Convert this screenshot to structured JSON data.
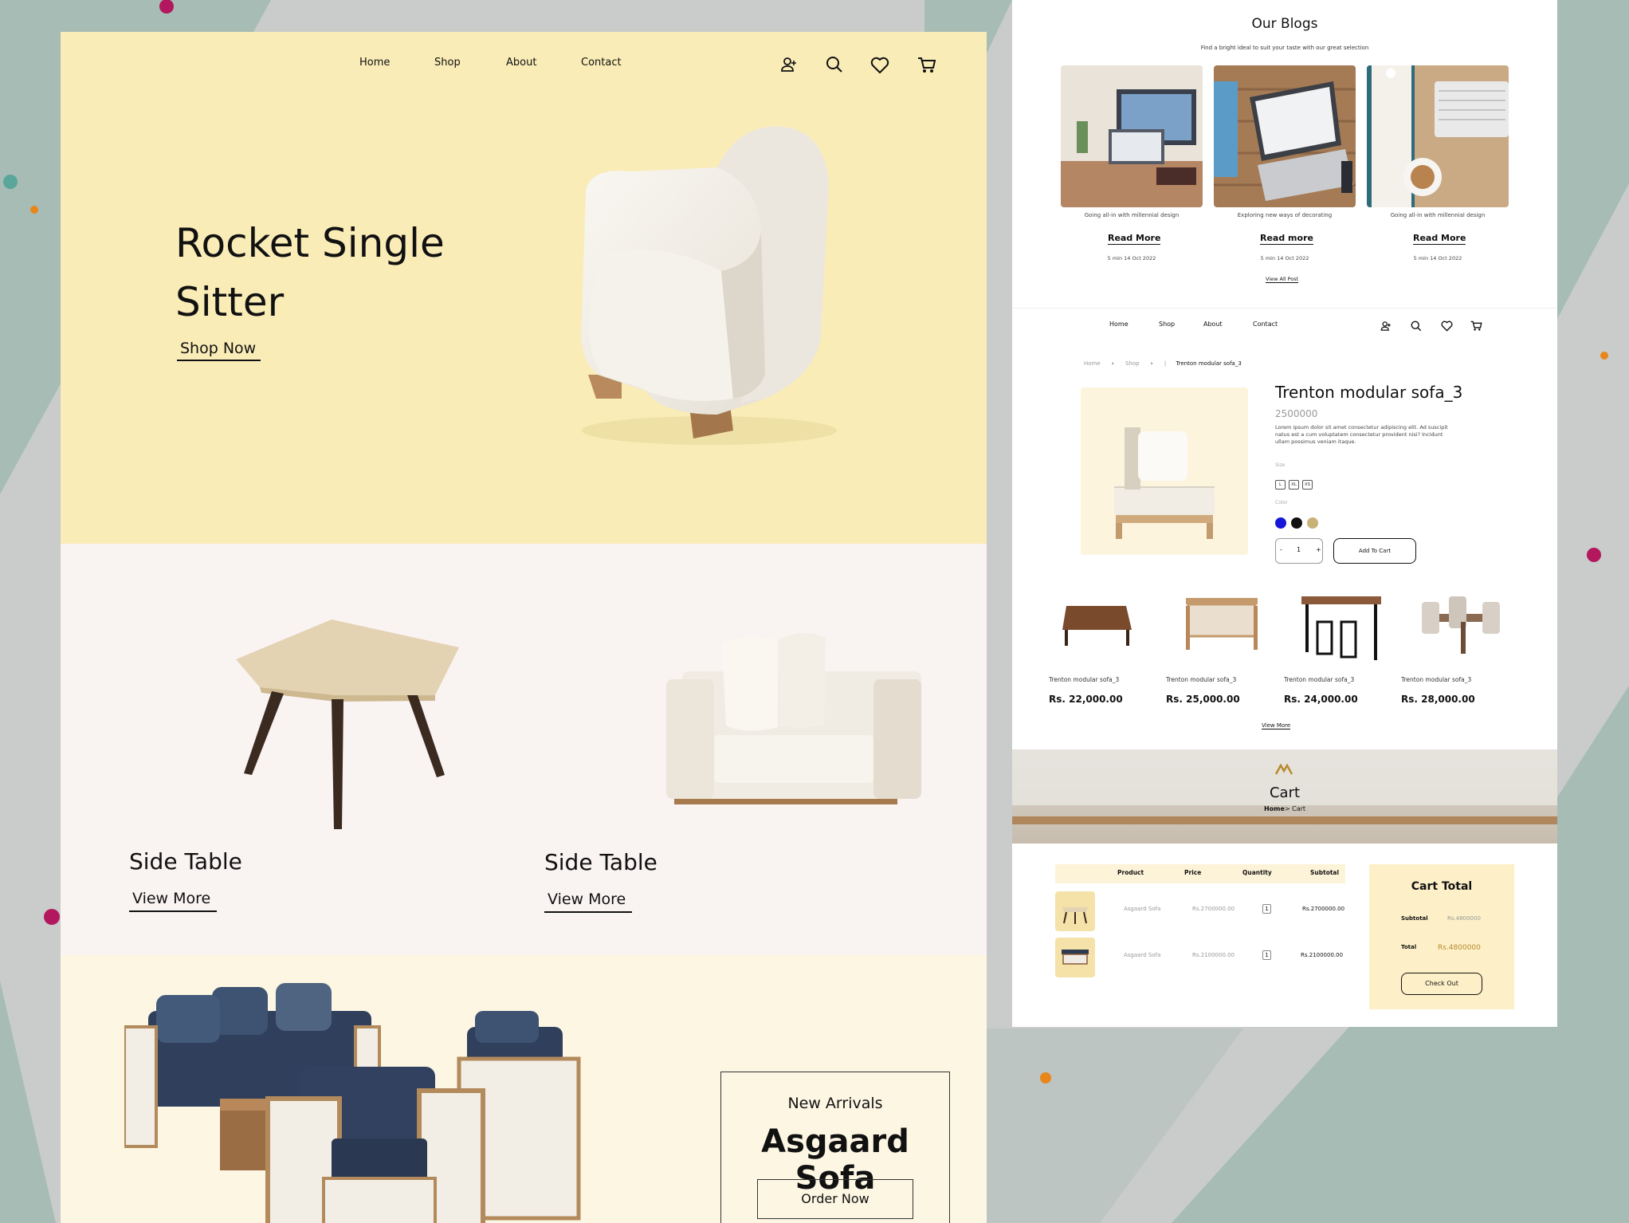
{
  "colors": {
    "background": "#c9cccb",
    "teal_band": "#a6bcb5",
    "hero_bg": "#f9ecb7",
    "section2_bg": "#f9f3f2",
    "section3_bg": "#fdf6e3",
    "accent_gold": "#b88a2e",
    "dot_magenta": "#b3185f",
    "dot_orange": "#e8861c",
    "dot_teal": "#5aa69a"
  },
  "left_page": {
    "nav": {
      "links": [
        "Home",
        "Shop",
        "About",
        "Contact"
      ],
      "icons": [
        "account-icon",
        "search-icon",
        "heart-icon",
        "cart-icon"
      ]
    },
    "hero": {
      "title": "Rocket Single Sitter",
      "cta": "Shop Now"
    },
    "products": [
      {
        "title": "Side Table",
        "link": "View More"
      },
      {
        "title": "Side Table",
        "link": "View More"
      }
    ],
    "new_arrivals": {
      "label": "New Arrivals",
      "title": "Asgaard Sofa",
      "button": "Order Now"
    }
  },
  "right_page": {
    "blogs": {
      "title": "Our Blogs",
      "subtitle": "Find a bright ideal to suit your taste with our great selection",
      "posts": [
        {
          "caption": "Going all-in with millennial design",
          "link": "Read More",
          "meta": "5 min   14 Oct 2022"
        },
        {
          "caption": "Exploring new ways of decorating",
          "link": "Read more",
          "meta": "5 min   14 Oct 2022"
        },
        {
          "caption": "Going all-in with millennial design",
          "link": "Read More",
          "meta": "5 min   14 Oct 2022"
        }
      ],
      "view_all": "View All Post"
    },
    "nav": {
      "links": [
        "Home",
        "Shop",
        "About",
        "Contact"
      ]
    },
    "breadcrumb": {
      "home": "Home",
      "shop": "Shop",
      "current": "Trenton modular sofa_3"
    },
    "product": {
      "name": "Trenton modular sofa_3",
      "price": "2500000",
      "description": "Lorem ipsum dolor sit amet consectetur adipiscing elit. Ad suscipit natus est a cum voluptatem consectetur provident nisi? Incidunt ullam possimus veniam itaque.",
      "size_label": "Size",
      "sizes": [
        "L",
        "XL",
        "XS"
      ],
      "color_label": "Color",
      "colors": [
        "#1717d9",
        "#111111",
        "#c8b276"
      ],
      "qty_minus": "-",
      "qty": "1",
      "qty_plus": "+",
      "add_to_cart": "Add To Cart"
    },
    "related": [
      {
        "name": "Trenton modular sofa_3",
        "price": "Rs. 22,000.00"
      },
      {
        "name": "Trenton modular sofa_3",
        "price": "Rs. 25,000.00"
      },
      {
        "name": "Trenton modular sofa_3",
        "price": "Rs. 24,000.00"
      },
      {
        "name": "Trenton modular sofa_3",
        "price": "Rs. 28,000.00"
      }
    ],
    "related_view_more": "View More",
    "cart_banner": {
      "title": "Cart",
      "crumb_home": "Home",
      "crumb_current": "> Cart"
    },
    "cart_table": {
      "headers": [
        "Product",
        "Price",
        "Quantity",
        "Subtotal"
      ],
      "rows": [
        {
          "name": "Asgaard Sofa",
          "price": "Rs.2700000.00",
          "qty": "1",
          "subtotal": "Rs.2700000.00"
        },
        {
          "name": "Asgaard Sofa",
          "price": "Rs.2100000.00",
          "qty": "1",
          "subtotal": "Rs.2100000.00"
        }
      ]
    },
    "cart_total": {
      "title": "Cart Total",
      "subtotal_label": "Subtotal",
      "subtotal_value": "Rs.4800000",
      "total_label": "Total",
      "total_value": "Rs.4800000",
      "button": "Check Out"
    }
  }
}
